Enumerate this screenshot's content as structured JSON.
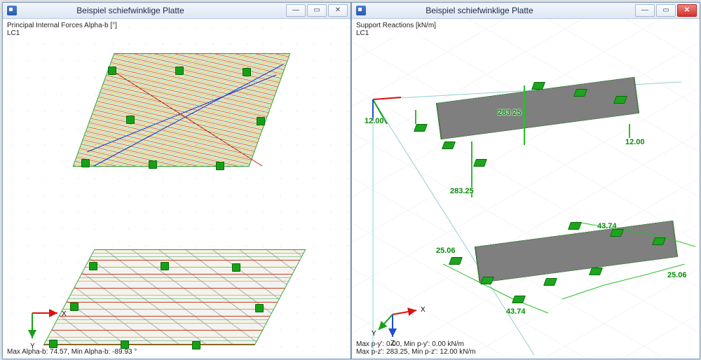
{
  "left_window": {
    "title": "Beispiel schiefwinklige Platte",
    "header": "Principal Internal Forces Alpha-b [°]\nLC1",
    "footer": "Max Alpha-b: 74.57, Min Alpha-b: -89.93 °",
    "axes": {
      "x": "X",
      "y": "Y"
    },
    "buttons": {
      "minimize": "—",
      "maximize": "▭",
      "close": "✕"
    },
    "result_type": "Principal Internal Forces",
    "quantity": "Alpha-b",
    "unit": "°",
    "load_case": "LC1",
    "max_value": 74.57,
    "min_value": -89.93
  },
  "right_window": {
    "title": "Beispiel schiefwinklige Platte",
    "header": "Support Reactions [kN/m]\nLC1",
    "footer": "Max p-y': 0.00, Min p-y': 0.00 kN/m\nMax p-z': 283.25, Min p-z': 12.00 kN/m",
    "axes": {
      "x": "X",
      "y": "Y",
      "z": "Z"
    },
    "buttons": {
      "minimize": "—",
      "maximize": "▭",
      "close": "✕"
    },
    "result_type": "Support Reactions",
    "unit": "kN/m",
    "load_case": "LC1",
    "py_max": 0.0,
    "py_min": 0.0,
    "pz_max": 283.25,
    "pz_min": 12.0,
    "plate_top": {
      "values": {
        "left_peak": "283.25",
        "right_near": "12.00",
        "left_near": "12.00",
        "right_peak": "283.25"
      }
    },
    "plate_bottom": {
      "values": {
        "left_side": "25.06",
        "right_top": "43.74",
        "left_bot": "43.74",
        "right_side": "25.06"
      }
    }
  }
}
